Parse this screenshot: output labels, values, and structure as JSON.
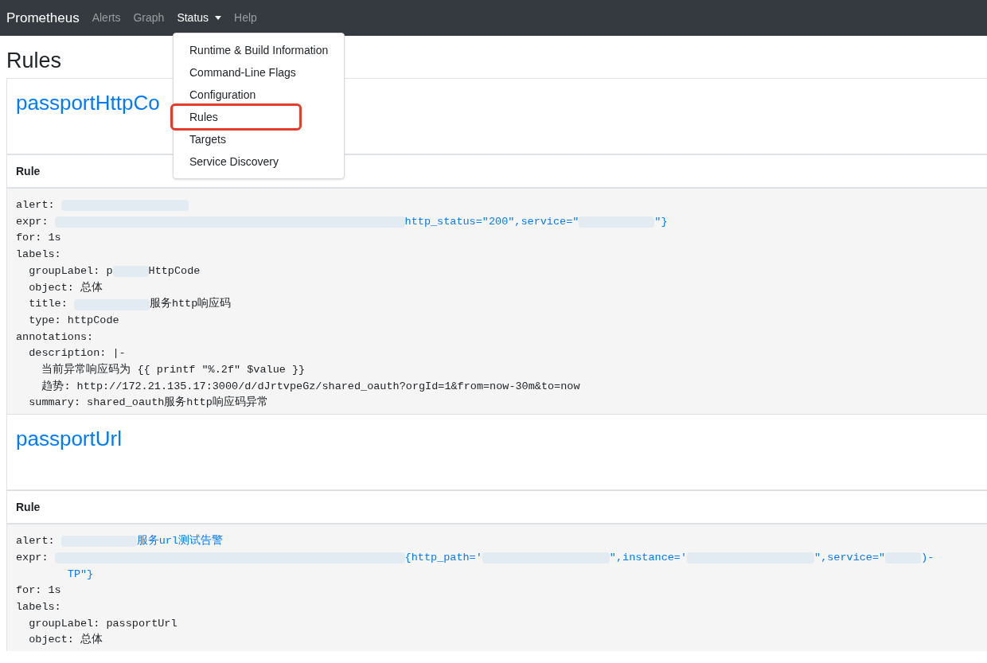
{
  "navbar": {
    "brand": "Prometheus",
    "items": [
      {
        "label": "Alerts",
        "active": false,
        "dropdown": false
      },
      {
        "label": "Graph",
        "active": false,
        "dropdown": false
      },
      {
        "label": "Status",
        "active": true,
        "dropdown": true
      },
      {
        "label": "Help",
        "active": false,
        "dropdown": false
      }
    ]
  },
  "dropdown": {
    "items": [
      {
        "label": "Runtime & Build Information",
        "highlighted": false
      },
      {
        "label": "Command-Line Flags",
        "highlighted": false
      },
      {
        "label": "Configuration",
        "highlighted": false
      },
      {
        "label": "Rules",
        "highlighted": true
      },
      {
        "label": "Targets",
        "highlighted": false
      },
      {
        "label": "Service Discovery",
        "highlighted": false
      }
    ]
  },
  "page_title": "Rules",
  "groups": [
    {
      "name": "passportHttpCo",
      "column": "Rule",
      "lines": [
        {
          "parts": [
            {
              "kind": "text",
              "text": "alert: "
            },
            {
              "kind": "blurmedium"
            }
          ]
        },
        {
          "parts": [
            {
              "kind": "text",
              "text": "expr: "
            },
            {
              "kind": "blurlong"
            },
            {
              "kind": "link",
              "text": "http_status=\"200\",service=\""
            },
            {
              "kind": "blurshort"
            },
            {
              "kind": "link",
              "text": "\"}"
            }
          ]
        },
        {
          "parts": [
            {
              "kind": "text",
              "text": "for: 1s"
            }
          ]
        },
        {
          "parts": [
            {
              "kind": "text",
              "text": "labels:"
            }
          ]
        },
        {
          "parts": [
            {
              "kind": "text",
              "text": "  groupLabel: p"
            },
            {
              "kind": "blurtiny"
            },
            {
              "kind": "text",
              "text": "HttpCode"
            }
          ]
        },
        {
          "parts": [
            {
              "kind": "text",
              "text": "  object: 总体"
            }
          ]
        },
        {
          "parts": [
            {
              "kind": "text",
              "text": "  title: "
            },
            {
              "kind": "blurshort"
            },
            {
              "kind": "text",
              "text": "服务http响应码"
            }
          ]
        },
        {
          "parts": [
            {
              "kind": "text",
              "text": "  type: httpCode"
            }
          ]
        },
        {
          "parts": [
            {
              "kind": "text",
              "text": "annotations:"
            }
          ]
        },
        {
          "parts": [
            {
              "kind": "text",
              "text": "  description: |-"
            }
          ]
        },
        {
          "parts": [
            {
              "kind": "text",
              "text": "    当前异常响应码为 {{ printf \"%.2f\" $value }}"
            }
          ]
        },
        {
          "parts": [
            {
              "kind": "text",
              "text": "    趋势: http://172.21.135.17:3000/d/dJrtvpeGz/shared_oauth?orgId=1&from=now-30m&to=now"
            }
          ]
        },
        {
          "parts": [
            {
              "kind": "text",
              "text": "  summary: shared_oauth服务http响应码异常"
            }
          ]
        }
      ]
    },
    {
      "name": "passportUrl",
      "column": "Rule",
      "lines": [
        {
          "parts": [
            {
              "kind": "text",
              "text": "alert: "
            },
            {
              "kind": "blurshort"
            },
            {
              "kind": "link",
              "text": "服务url测试告警"
            }
          ]
        },
        {
          "parts": [
            {
              "kind": "text",
              "text": "expr: "
            },
            {
              "kind": "blurlong"
            },
            {
              "kind": "link",
              "text": "{http_path='"
            },
            {
              "kind": "blurmedium"
            },
            {
              "kind": "link",
              "text": "\",instance='"
            },
            {
              "kind": "blurmedium"
            },
            {
              "kind": "link",
              "text": "\",service=\""
            },
            {
              "kind": "blurtiny"
            },
            {
              "kind": "link",
              "text": ")-"
            }
          ]
        },
        {
          "parts": [
            {
              "kind": "link",
              "text": "        TP\"}"
            }
          ]
        },
        {
          "parts": [
            {
              "kind": "text",
              "text": "for: 1s"
            }
          ]
        },
        {
          "parts": [
            {
              "kind": "text",
              "text": "labels:"
            }
          ]
        },
        {
          "parts": [
            {
              "kind": "text",
              "text": "  groupLabel: passportUrl"
            }
          ]
        },
        {
          "parts": [
            {
              "kind": "text",
              "text": "  object: 总体"
            }
          ]
        }
      ]
    }
  ]
}
